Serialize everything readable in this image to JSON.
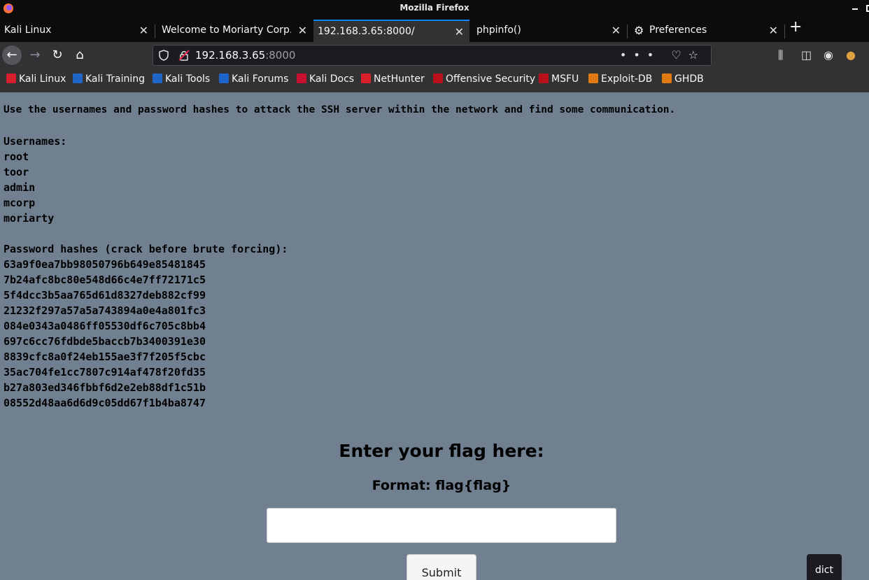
{
  "window": {
    "title": "Mozilla Firefox"
  },
  "tabs": [
    {
      "label": "Kali Linux",
      "active": false
    },
    {
      "label": "Welcome to Moriarty Corp. E",
      "active": false
    },
    {
      "label": "192.168.3.65:8000/",
      "active": true
    },
    {
      "label": "phpinfo()",
      "active": false
    },
    {
      "label": "Preferences",
      "active": false
    }
  ],
  "urlbar": {
    "host": "192.168.3.65",
    "port": ":8000"
  },
  "bookmarks": [
    {
      "label": "Kali Linux",
      "color": "#d8202c"
    },
    {
      "label": "Kali Training",
      "color": "#1e66c8"
    },
    {
      "label": "Kali Tools",
      "color": "#1e66c8"
    },
    {
      "label": "Kali Forums",
      "color": "#1e66c8"
    },
    {
      "label": "Kali Docs",
      "color": "#c8102e"
    },
    {
      "label": "NetHunter",
      "color": "#d8202c"
    },
    {
      "label": "Offensive Security",
      "color": "#b8101c"
    },
    {
      "label": "MSFU",
      "color": "#b8101c"
    },
    {
      "label": "Exploit-DB",
      "color": "#e07a10"
    },
    {
      "label": "GHDB",
      "color": "#e07a10"
    }
  ],
  "content": {
    "intro": "Use the usernames and password hashes to attack the SSH server within the network and find some communication.",
    "usernames_heading": "Usernames:",
    "usernames": [
      "root",
      "toor",
      "admin",
      "mcorp",
      "moriarty"
    ],
    "hashes_heading": "Password hashes (crack before brute forcing):",
    "hashes": [
      "63a9f0ea7bb98050796b649e85481845",
      "7b24afc8bc80e548d66c4e7ff72171c5",
      "5f4dcc3b5aa765d61d8327deb882cf99",
      "21232f297a57a5a743894a0e4a801fc3",
      "084e0343a0486ff05530df6c705c8bb4",
      "697c6cc76fdbde5baccb7b3400391e30",
      "8839cfc8a0f24eb155ae3f7f205f5cbc",
      "35ac704fe1cc7807c914af478f20fd35",
      "b27a803ed346fbbf6d2e2eb88df1c51b",
      "08552d48aa6d6d9c05dd67f1b4ba8747"
    ],
    "flag_heading": "Enter your flag here:",
    "flag_format": "Format: flag{flag}",
    "submit_label": "Submit",
    "tooltip": "dict"
  }
}
